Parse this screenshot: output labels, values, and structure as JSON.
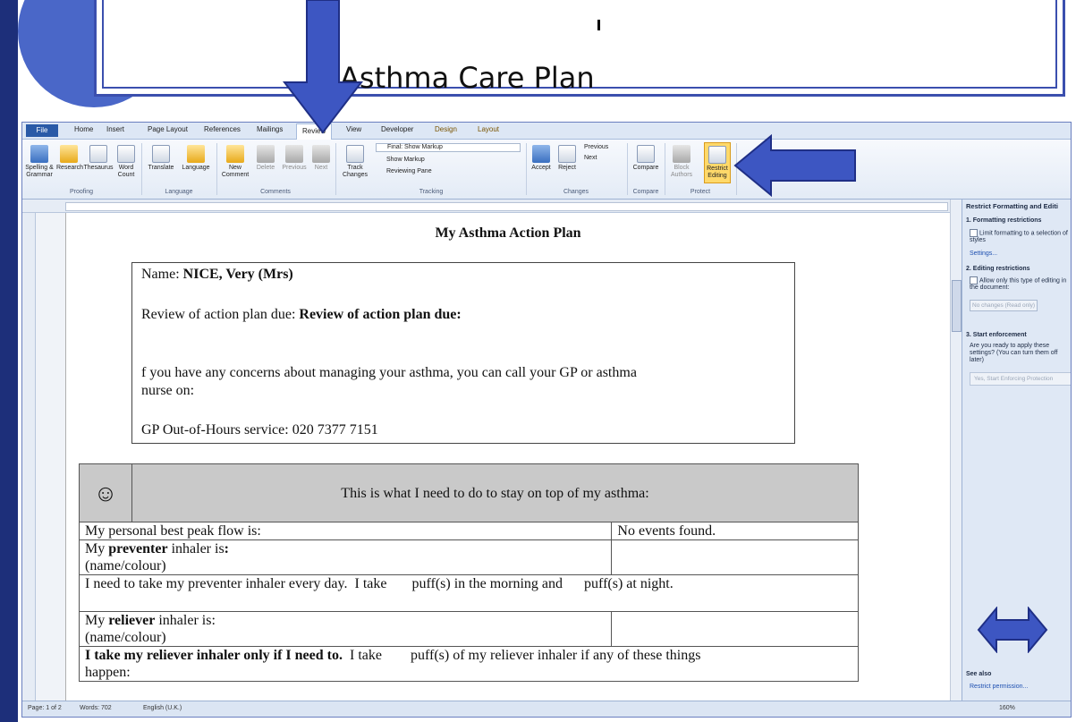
{
  "slide": {
    "title": "Asthma Care Plan"
  },
  "ribbon": {
    "tabs": [
      "File",
      "Home",
      "Insert",
      "Page Layout",
      "References",
      "Mailings",
      "Review",
      "View",
      "Developer",
      "Design",
      "Layout"
    ],
    "active_tab": "Review",
    "groups": {
      "proofing": {
        "label": "Proofing",
        "buttons": [
          "Spelling & Grammar",
          "Research",
          "Thesaurus",
          "Word Count"
        ]
      },
      "language": {
        "label": "Language",
        "buttons": [
          "Translate",
          "Language"
        ]
      },
      "comments": {
        "label": "Comments",
        "buttons": [
          "New Comment",
          "Delete",
          "Previous",
          "Next"
        ]
      },
      "tracking": {
        "label": "Tracking",
        "track_changes": "Track Changes",
        "final_markup": "Final: Show Markup",
        "show_markup": "Show Markup",
        "reviewing_pane": "Reviewing Pane"
      },
      "changes": {
        "label": "Changes",
        "accept": "Accept",
        "reject": "Reject",
        "previous": "Previous",
        "next": "Next"
      },
      "compare": {
        "label": "Compare",
        "compare": "Compare"
      },
      "protect": {
        "label": "Protect",
        "block_authors": "Block Authors",
        "restrict_editing": "Restrict Editing"
      }
    }
  },
  "document": {
    "title": "My Asthma Action Plan",
    "name_label": "Name: ",
    "name_value": "NICE, Very (Mrs)",
    "review_label": "Review of action plan due: ",
    "review_value": "Review of action plan due:",
    "concerns_text": " f you have any concerns about managing your asthma, you can call your GP or asthma",
    "concerns_text2": "nurse on:",
    "gp_service": "GP Out-of-Hours service: 020 7377 7151",
    "table": {
      "smiley": "☺",
      "header": "This is what I need to do to stay on top of my asthma:",
      "peak_flow_label": "My personal best peak flow is:",
      "peak_flow_value": "No events found.",
      "preventer_pre": "My ",
      "preventer_bold": "preventer",
      "preventer_post": " inhaler is",
      "preventer_colon": ":",
      "preventer_sub": "(name/colour)",
      "preventer_daily": "I need to take my preventer inhaler every day.  I take       puff(s) in the morning and      puff(s) at night.",
      "reliever_pre": "My ",
      "reliever_bold": "reliever",
      "reliever_post": " inhaler is:",
      "reliever_sub": "(name/colour)",
      "reliever_only_bold": "I take my reliever inhaler only if I need to.",
      "reliever_only_rest": "  I take        puff(s) of my reliever inhaler if any of these things",
      "reliever_only_rest2": "happen:"
    }
  },
  "task_pane": {
    "title": "Restrict Formatting and Editi",
    "section1": "1. Formatting restrictions",
    "limit_formatting": "Limit formatting to a selection of styles",
    "settings_link": "Settings...",
    "section2": "2. Editing restrictions",
    "allow_only": "Allow only this type of editing in the document:",
    "editing_dropdown": "No changes (Read only)",
    "section3": "3. Start enforcement",
    "ready_text": "Are you ready to apply these settings? (You can turn them off later)",
    "enforce_button": "Yes, Start Enforcing Protection",
    "see_also": "See also",
    "restrict_permission": "Restrict permission..."
  },
  "status_bar": {
    "page": "Page: 1 of 2",
    "words": "Words: 702",
    "language": "English (U.K.)",
    "zoom": "160%"
  },
  "annotations": {
    "arrow_color": "#3d56c2",
    "arrow_stroke": "#1f2f86"
  }
}
